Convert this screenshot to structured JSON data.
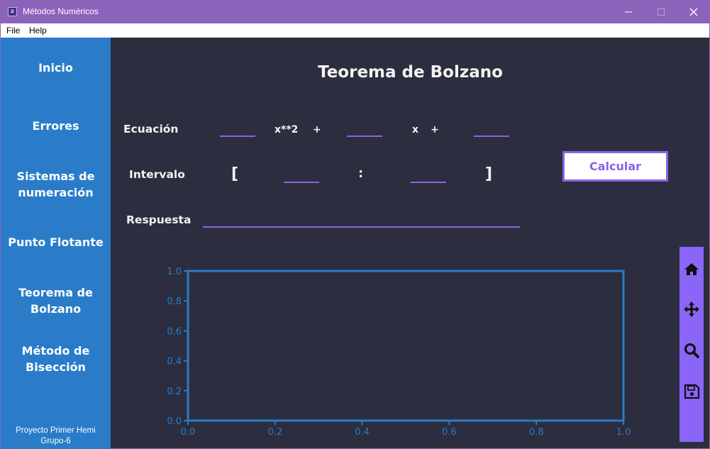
{
  "window": {
    "title": "Métodos Numéricos",
    "icon_glyph": "≥"
  },
  "menubar": {
    "items": [
      "File",
      "Help"
    ]
  },
  "sidebar": {
    "items": [
      {
        "line1": "Inicio",
        "line2": ""
      },
      {
        "line1": "Errores",
        "line2": ""
      },
      {
        "line1": "Sistemas de",
        "line2": "numeración"
      },
      {
        "line1": "Punto Flotante",
        "line2": ""
      },
      {
        "line1": "Teorema de",
        "line2": "Bolzano"
      },
      {
        "line1": "Método de",
        "line2": "Bisección"
      }
    ],
    "footer_line1": "Proyecto Primer Hemi",
    "footer_line2": "Grupo-6"
  },
  "main": {
    "title": "Teorema de Bolzano",
    "equation_label": "Ecuación",
    "term_x2": "x**2",
    "plus1": "+",
    "term_x": "x",
    "plus2": "+",
    "interval_label": "Intervalo",
    "bracket_open": "[",
    "colon": ":",
    "bracket_close": "]",
    "answer_label": "Respuesta",
    "calculate_label": "Calcular",
    "fields": {
      "coef_a": "",
      "coef_b": "",
      "coef_c": "",
      "interval_a": "",
      "interval_b": "",
      "answer": ""
    }
  },
  "toolbar_icons": [
    "home-icon",
    "move-icon",
    "zoom-icon",
    "save-icon"
  ],
  "colors": {
    "titlebar": "#8c63bb",
    "sidebar": "#2a7cc9",
    "background": "#2c2d3e",
    "accent": "#8a65f7",
    "axis": "#2a7cc9"
  },
  "chart_data": {
    "type": "line",
    "series": [],
    "xlim": [
      0.0,
      1.0
    ],
    "ylim": [
      0.0,
      1.0
    ],
    "xticks": [
      "0.0",
      "0.2",
      "0.4",
      "0.6",
      "0.8",
      "1.0"
    ],
    "yticks": [
      "0.0",
      "0.2",
      "0.4",
      "0.6",
      "0.8",
      "1.0"
    ],
    "title": "",
    "xlabel": "",
    "ylabel": "",
    "grid": false
  }
}
